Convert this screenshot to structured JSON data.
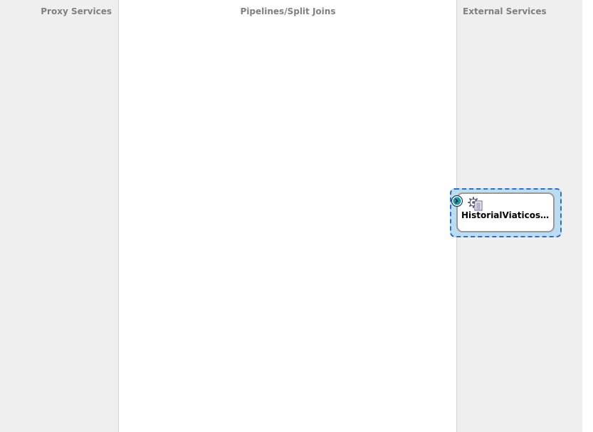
{
  "lanes": {
    "proxy_services": {
      "title": "Proxy Services"
    },
    "pipelines": {
      "title": "Pipelines/Split Joins"
    },
    "external_services": {
      "title": "External Services"
    }
  },
  "external_service": {
    "name": "HistorialViaticosE...",
    "type_icon": "business-service-gear-icon",
    "endpoint_icon": "service-endpoint-arrow-icon",
    "selected": true
  },
  "colors": {
    "lane_background": "#efefef",
    "canvas_background": "#ffffff",
    "lane_title": "#808080",
    "selection_fill": "#bcdcf2",
    "selection_border": "#2f6fc8",
    "endpoint_teal": "#1a9aa5"
  }
}
